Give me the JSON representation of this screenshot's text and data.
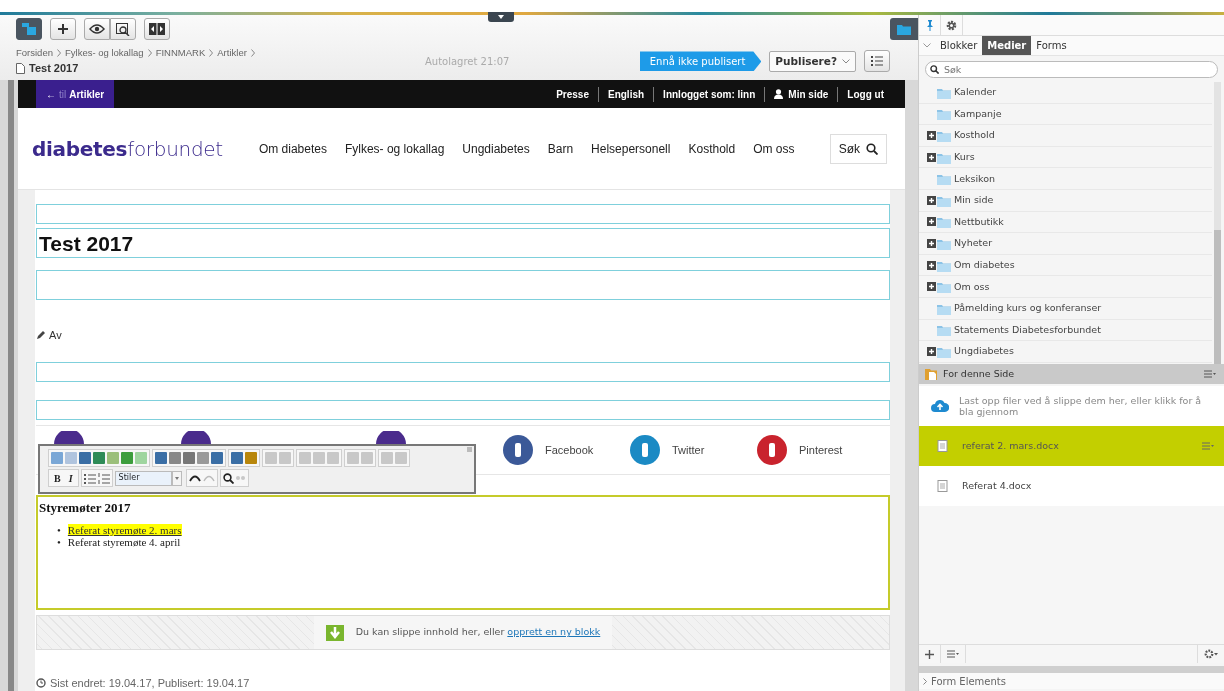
{
  "topbar": {
    "breadcrumb": [
      "Forsiden",
      "Fylkes- og lokallag",
      "FINNMARK",
      "Artikler"
    ],
    "page_title": "Test 2017",
    "autosave": "Autolagret 21:07",
    "status": "Ennå ikke publisert",
    "publish_button": "Publisere?"
  },
  "site": {
    "back_link": {
      "arrow": "←",
      "prefix": "til",
      "label": "Artikler"
    },
    "top_links": [
      {
        "label": "Presse",
        "kind": "text"
      },
      {
        "label": "English",
        "kind": "text"
      },
      {
        "label": "Innlogget som: linn",
        "kind": "text"
      },
      {
        "label": "Min side",
        "kind": "user"
      },
      {
        "label": "Logg ut",
        "kind": "text"
      }
    ],
    "logo": "**diabetes**forbundet",
    "nav": [
      "Om diabetes",
      "Fylkes- og lokallag",
      "Ungdiabetes",
      "Barn",
      "Helsepersonell",
      "Kosthold",
      "Om oss"
    ],
    "search_label": "Søk"
  },
  "article": {
    "title": "Test 2017",
    "author_label": "Av",
    "share": [
      {
        "kind": "circle",
        "color": "#4a2b8c"
      },
      {
        "kind": "circle",
        "color": "#4a2b8c"
      },
      {
        "kind": "circle",
        "color": "#4a2b8c"
      },
      {
        "kind": "labeled",
        "label": "Facebook",
        "color": "#3b5998"
      },
      {
        "kind": "labeled",
        "label": "Twitter",
        "color": "#1b8ac4"
      },
      {
        "kind": "labeled",
        "label": "Pinterest",
        "color": "#c9232d"
      }
    ],
    "editor_toolbar": {
      "bold": "B",
      "italic": "I",
      "style_select": "Stiler"
    },
    "content_block": {
      "heading": "Styremøter 2017",
      "items": [
        {
          "marker": "•",
          "text": "Referat styremøte 2. mars",
          "link": true,
          "highlighted": true
        },
        {
          "marker": "•",
          "text": "Referat styremøte 4. april",
          "link": false,
          "highlighted": false
        }
      ]
    },
    "drop_zone": {
      "text": "Du kan slippe innhold her, eller ",
      "link": "opprett en ny blokk"
    },
    "footer": "Sist endret: 19.04.17, Publisert: 19.04.17"
  },
  "panel": {
    "tabs": [
      {
        "label": "Blokker",
        "selected": false
      },
      {
        "label": "Medier",
        "selected": true
      },
      {
        "label": "Forms",
        "selected": false
      }
    ],
    "search": {
      "placeholder": "Søk"
    },
    "tree": [
      {
        "label": "Kalender",
        "expandable": false
      },
      {
        "label": "Kampanje",
        "expandable": false
      },
      {
        "label": "Kosthold",
        "expandable": true
      },
      {
        "label": "Kurs",
        "expandable": true
      },
      {
        "label": "Leksikon",
        "expandable": false
      },
      {
        "label": "Min side",
        "expandable": true
      },
      {
        "label": "Nettbutikk",
        "expandable": true
      },
      {
        "label": "Nyheter",
        "expandable": true
      },
      {
        "label": "Om diabetes",
        "expandable": true
      },
      {
        "label": "Om oss",
        "expandable": true
      },
      {
        "label": "Påmelding kurs og konferanser",
        "expandable": false
      },
      {
        "label": "Statements Diabetesforbundet",
        "expandable": false
      },
      {
        "label": "Ungdiabetes",
        "expandable": true
      }
    ],
    "section_title": "For denne Side",
    "upload_hint": "Last opp filer ved å slippe dem her, eller klikk for å bla gjennom",
    "files": [
      {
        "name": "referat 2. mars.docx",
        "selected": true
      },
      {
        "name": "Referat 4.docx",
        "selected": false
      }
    ],
    "bottom_section": "Form Elements"
  }
}
